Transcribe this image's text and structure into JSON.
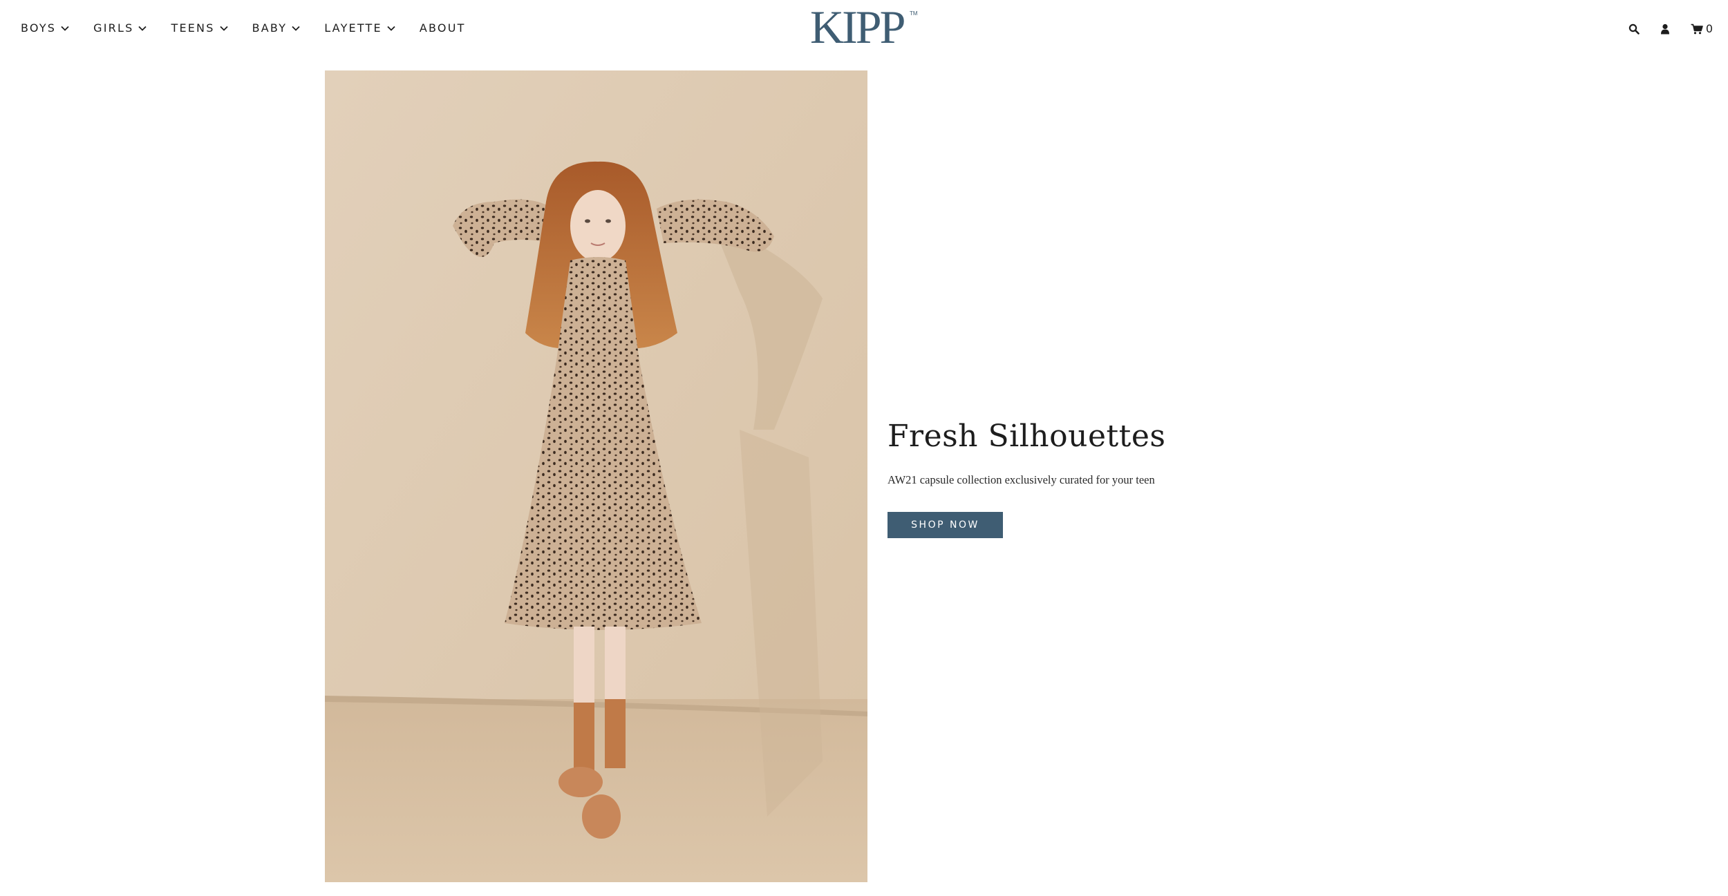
{
  "nav": {
    "items": [
      {
        "label": "BOYS",
        "has_dropdown": true
      },
      {
        "label": "GIRLS",
        "has_dropdown": true
      },
      {
        "label": "TEENS",
        "has_dropdown": true
      },
      {
        "label": "BABY",
        "has_dropdown": true
      },
      {
        "label": "LAYETTE",
        "has_dropdown": true
      },
      {
        "label": "ABOUT",
        "has_dropdown": false
      }
    ]
  },
  "brand": {
    "logo_text": "KIPP",
    "trademark": "TM",
    "color": "#3f5d73"
  },
  "utilities": {
    "search_icon": "search-icon",
    "account_icon": "user-icon",
    "cart_icon": "cart-icon",
    "cart_count": "0"
  },
  "hero": {
    "title": "Fresh Silhouettes",
    "subtitle": "AW21 capsule collection exclusively curated for your teen",
    "cta_label": "SHOP NOW",
    "cta_color": "#3f5d73",
    "image_background": "#dcc8b0"
  }
}
